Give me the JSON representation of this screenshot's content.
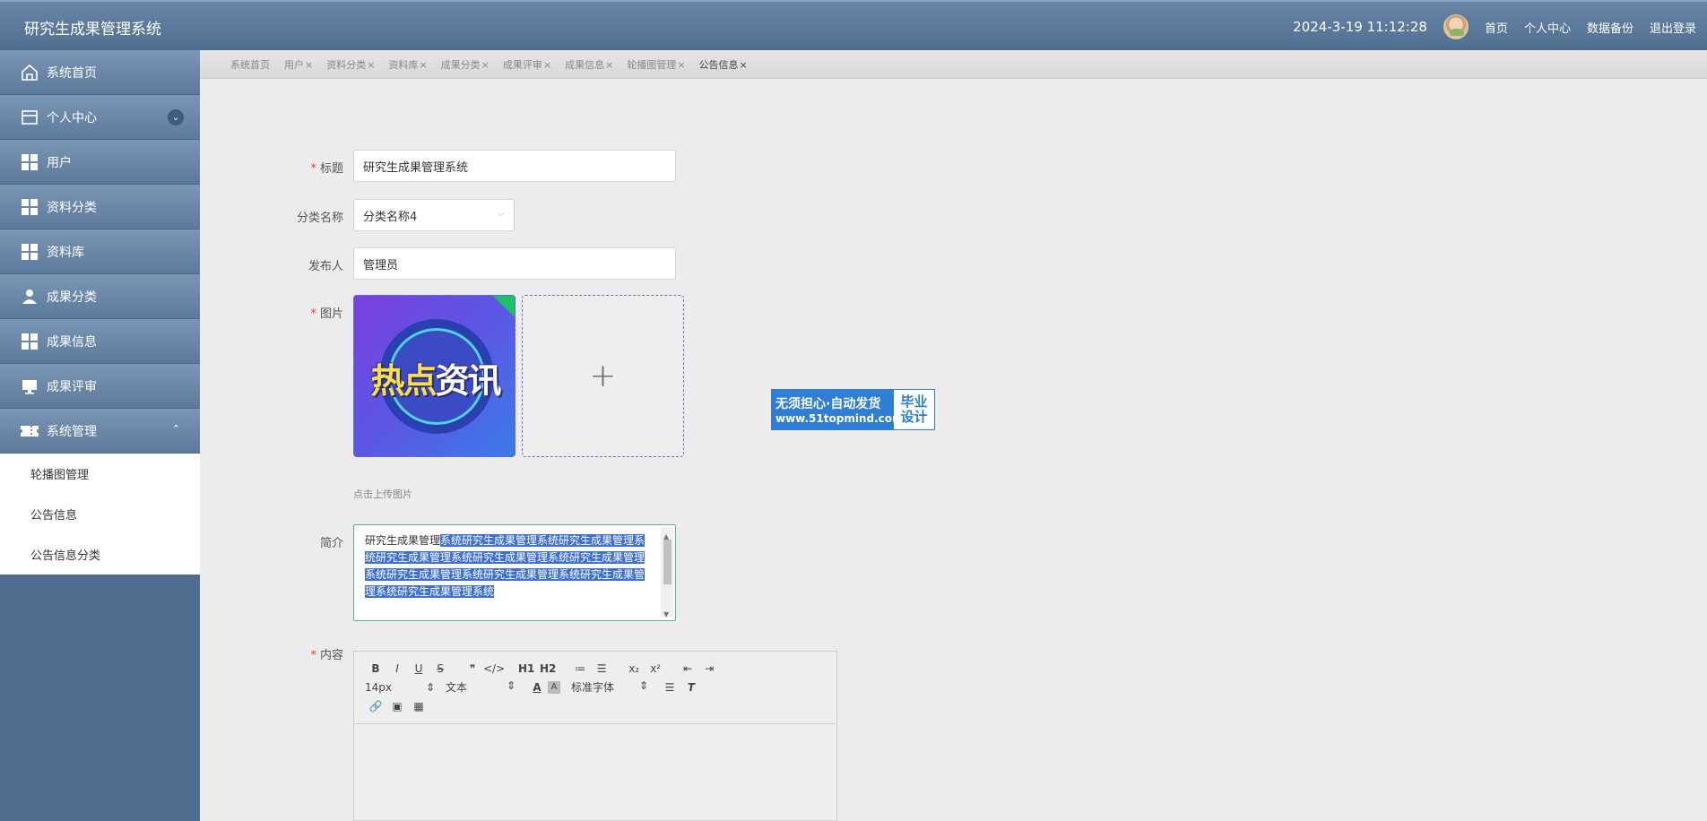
{
  "header": {
    "app_title": "研究生成果管理系统",
    "datetime": "2024-3-19 11:12:28",
    "links": [
      "首页",
      "个人中心",
      "数据备份",
      "退出登录"
    ]
  },
  "sidebar": {
    "items": [
      {
        "label": "系统首页"
      },
      {
        "label": "个人中心"
      },
      {
        "label": "用户"
      },
      {
        "label": "资料分类"
      },
      {
        "label": "资料库"
      },
      {
        "label": "成果分类"
      },
      {
        "label": "成果信息"
      },
      {
        "label": "成果评审"
      },
      {
        "label": "系统管理"
      }
    ],
    "submenu": [
      "轮播图管理",
      "公告信息",
      "公告信息分类"
    ]
  },
  "tabs": [
    {
      "label": "系统首页",
      "close": ""
    },
    {
      "label": "用户",
      "close": "×"
    },
    {
      "label": "资料分类",
      "close": "×"
    },
    {
      "label": "资料库",
      "close": "×"
    },
    {
      "label": "成果分类",
      "close": "×"
    },
    {
      "label": "成果评审",
      "close": "×"
    },
    {
      "label": "成果信息",
      "close": "×"
    },
    {
      "label": "轮播图管理",
      "close": "×"
    },
    {
      "label": "公告信息",
      "close": "×"
    }
  ],
  "form": {
    "title_label": "标题",
    "title_value": "研究生成果管理系统",
    "category_label": "分类名称",
    "category_value": "分类名称4",
    "publisher_label": "发布人",
    "publisher_value": "管理员",
    "image_label": "图片",
    "image_text_a": "热点",
    "image_text_b": "资讯",
    "upload_hint": "点击上传图片",
    "summary_label": "简介",
    "summary_plain": "研究生成果管理",
    "summary_selected": "系统研究生成果管理系统研究生成果管理系统研究生成果管理系统研究生成果管理系统研究生成果管理系统研究生成果管理系统研究生成果管理系统研究生成果管理系统研究生成果管理系统",
    "content_label": "内容"
  },
  "editor": {
    "row1": [
      "B",
      "I",
      "U",
      "S",
      "❞",
      "</>",
      "H1",
      "H2",
      "≔",
      "☰",
      "x₂",
      "x²",
      "⇤",
      "⇥"
    ],
    "font_size": "14px",
    "text_type": "文本",
    "font_family": "标准字体"
  },
  "watermark": {
    "line1": "无须担心·自动发货",
    "line2": "www.51topmind.com",
    "badge_line1": "毕业",
    "badge_line2": "设计"
  }
}
